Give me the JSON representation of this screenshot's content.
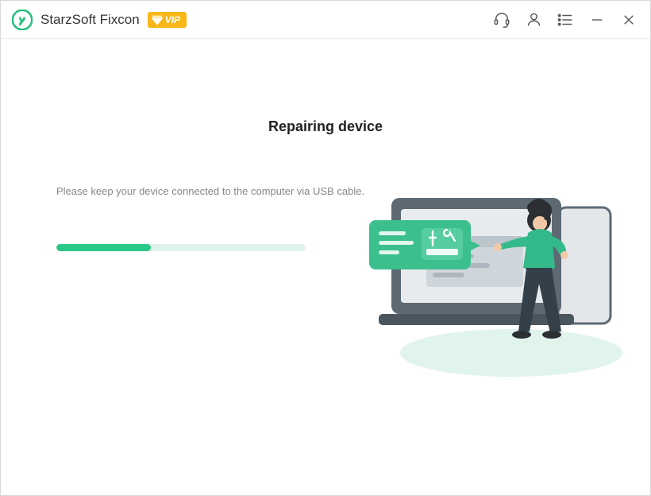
{
  "titlebar": {
    "app_name": "StarzSoft Fixcon",
    "vip_label": "VIP"
  },
  "main": {
    "heading": "Repairing device",
    "instruction": "Please keep your device connected to the computer via USB cable.",
    "progress_percent": 38
  },
  "colors": {
    "accent": "#2ac886",
    "vip": "#f8b617"
  }
}
